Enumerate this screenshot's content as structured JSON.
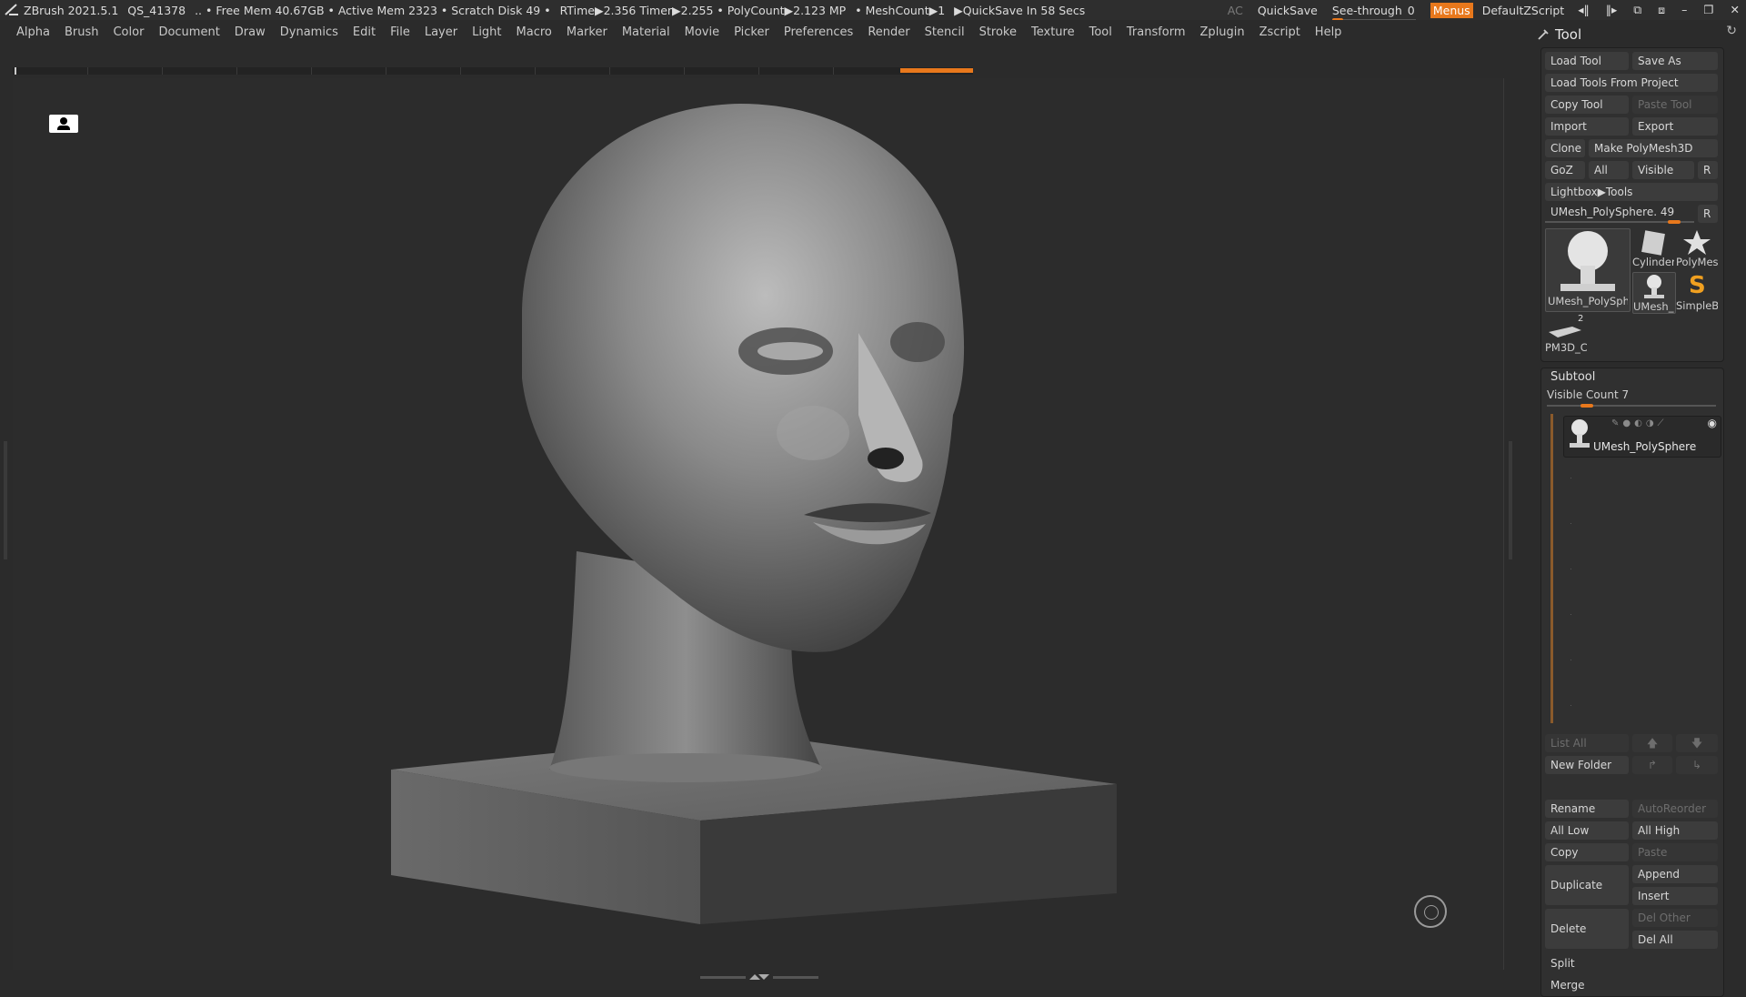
{
  "titlebar": {
    "app": "ZBrush 2021.5.1",
    "qs": "QS_41378",
    "mem": ".. • Free Mem 40.67GB • Active Mem 2323 • Scratch Disk 49 •",
    "rtime": "RTime▶2.356 Timer▶2.255 • PolyCount▶2.123 MP",
    "meshcount": "• MeshCount▶1",
    "quicksave_timer": "▶QuickSave In 58 Secs",
    "ac": "AC",
    "quicksave": "QuickSave",
    "seethrough_label": "See-through",
    "seethrough_value": "0",
    "seethrough_level": 0,
    "menus": "Menus",
    "script": "DefaultZScript"
  },
  "menubar": [
    "Alpha",
    "Brush",
    "Color",
    "Document",
    "Draw",
    "Dynamics",
    "Edit",
    "File",
    "Layer",
    "Light",
    "Macro",
    "Marker",
    "Material",
    "Movie",
    "Picker",
    "Preferences",
    "Render",
    "Stencil",
    "Stroke",
    "Texture",
    "Tool",
    "Transform",
    "Zplugin",
    "Zscript",
    "Help"
  ],
  "tool_panel": {
    "title": "Tool",
    "load_tool": "Load Tool",
    "save_as": "Save As",
    "load_from_project": "Load Tools From Project",
    "copy_tool": "Copy Tool",
    "paste_tool": "Paste Tool",
    "import": "Import",
    "export": "Export",
    "clone": "Clone",
    "make_polymesh": "Make PolyMesh3D",
    "goz": "GoZ",
    "all": "All",
    "visible": "Visible",
    "r": "R",
    "lightbox": "Lightbox▶Tools",
    "current_tool": "UMesh_PolySphere. 49",
    "current_tool_slider": 0.9,
    "thumbs": {
      "main": "UMesh_PolySphe",
      "cylinder": "Cylinder",
      "polymesh": "PolyMes",
      "umesh_small": "UMesh_",
      "simpleb": "SimpleB",
      "pm3d": "PM3D_C",
      "pm3d_badge": "2"
    }
  },
  "subtool": {
    "title": "Subtool",
    "visible_count": "Visible Count 7",
    "visible_count_level": 0.1,
    "item": "UMesh_PolySphere",
    "list_all": "List All",
    "new_folder": "New Folder",
    "rename": "Rename",
    "autoreorder": "AutoReorder",
    "all_low": "All Low",
    "all_high": "All High",
    "copy": "Copy",
    "paste": "Paste",
    "duplicate": "Duplicate",
    "append": "Append",
    "insert": "Insert",
    "delete": "Delete",
    "del_other": "Del Other",
    "del_all": "Del All",
    "split": "Split",
    "merge": "Merge"
  },
  "colors": {
    "accent": "#e8781c",
    "background": "#2b2b2b"
  }
}
